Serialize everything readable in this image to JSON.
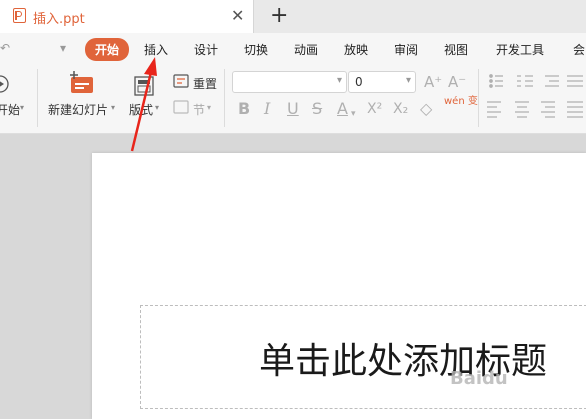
{
  "tab": {
    "title": "插入.ppt",
    "close": "✕",
    "new": "+"
  },
  "menu": {
    "quick": [
      "↶",
      "▾"
    ],
    "items": [
      "开始",
      "插入",
      "设计",
      "切换",
      "动画",
      "放映",
      "审阅",
      "视图",
      "开发工具",
      "会"
    ]
  },
  "ribbon": {
    "start_label": "开始",
    "new_slide": "新建幻灯片",
    "layout": "版式",
    "reset": "重置",
    "section": "节",
    "font_name": "",
    "font_size": "0",
    "grow": "A⁺",
    "shrink": "A⁻",
    "bold": "B",
    "italic": "I",
    "underline": "U",
    "strike": "S",
    "font_color": "A",
    "superscript": "X²",
    "subscript": "X₂",
    "clear": "◇",
    "phonetic": "wén 变"
  },
  "slide": {
    "title_placeholder": "单击此处添加标题"
  },
  "watermark": "Baidu",
  "colors": {
    "accent": "#e0643a",
    "arrow": "#e8251b"
  }
}
